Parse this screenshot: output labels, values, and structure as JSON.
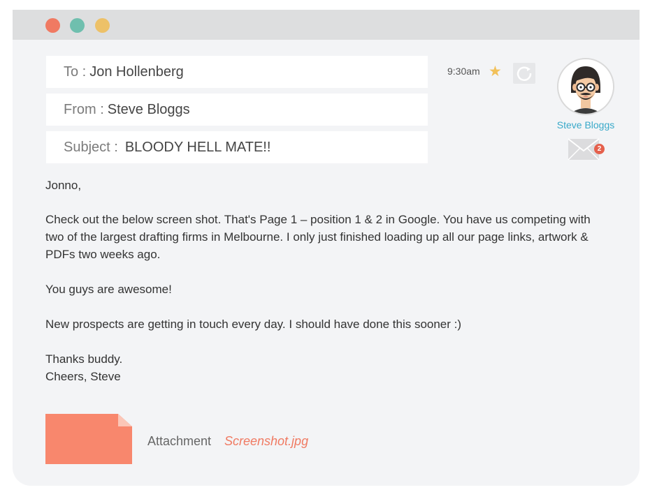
{
  "window": {
    "controls": [
      {
        "name": "close",
        "color": "#f07a62"
      },
      {
        "name": "minimize",
        "color": "#6fbfae"
      },
      {
        "name": "maximize",
        "color": "#edc168"
      }
    ]
  },
  "email": {
    "to_label": "To :",
    "to_value": "Jon Hollenberg",
    "from_label": "From :",
    "from_value": "Steve Bloggs",
    "subject_label": "Subject :",
    "subject_value": "BLOODY HELL MATE!!",
    "time": "9:30am",
    "star_icon": "star-icon",
    "refresh_icon": "refresh-icon"
  },
  "sender": {
    "name": "Steve Bloggs",
    "mail_icon": "envelope-icon",
    "unread_count": "2"
  },
  "body": {
    "greeting": "Jonno,",
    "paragraph1": "Check out the below screen shot. That's Page 1 – position 1 & 2 in Google. You have us competing with two of the largest drafting firms in Melbourne. I only just finished loading up all our page links, artwork & PDFs two weeks ago.",
    "paragraph2": "You guys are awesome!",
    "paragraph3": "New prospects are getting in touch every day. I should have done this sooner :)",
    "signoff1": "Thanks buddy.",
    "signoff2": "Cheers, Steve"
  },
  "attachment": {
    "label": "Attachment",
    "filename": "Screenshot.jpg",
    "color": "#f8876d"
  }
}
